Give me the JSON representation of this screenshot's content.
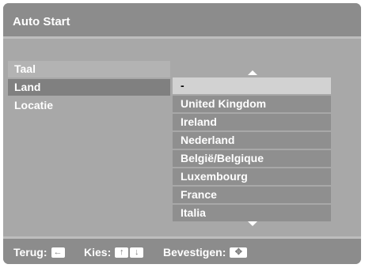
{
  "header": {
    "title": "Auto Start"
  },
  "menu": {
    "items": [
      {
        "label": "Taal"
      },
      {
        "label": "Land"
      },
      {
        "label": "Locatie"
      }
    ],
    "selected_index": 1
  },
  "country_list": {
    "items": [
      "-",
      "United Kingdom",
      "Ireland",
      "Nederland",
      "België/Belgique",
      "Luxembourg",
      "France",
      "Italia"
    ],
    "selected_index": 0
  },
  "footer": {
    "back_label": "Terug:",
    "select_label": "Kies:",
    "confirm_label": "Bevestigen:",
    "icons": {
      "back": "left-arrow-key-icon",
      "select_up": "up-arrow-key-icon",
      "select_down": "down-arrow-key-icon",
      "confirm": "center-dpad-key-icon"
    }
  },
  "colors": {
    "background": "#a8a8a8",
    "header": "#8c8c8c",
    "selected_menu": "#808080",
    "selected_list": "#d2d2d2",
    "list_item": "#8f8f8f"
  }
}
